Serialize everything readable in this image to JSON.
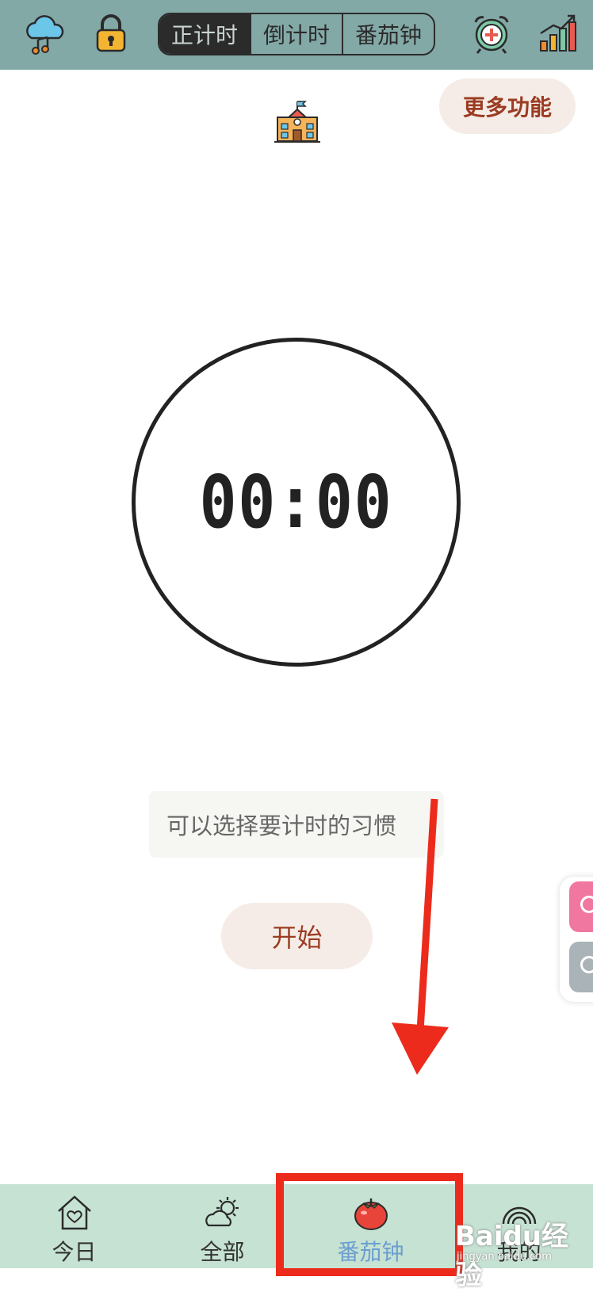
{
  "header": {
    "icons": [
      "cloud-music-icon",
      "lock-icon",
      "alarm-clock-icon",
      "bar-chart-icon"
    ],
    "segments": [
      "正计时",
      "倒计时",
      "番茄钟"
    ],
    "selected_segment": "正计时"
  },
  "more_button_label": "更多功能",
  "timer": {
    "display": "00:00"
  },
  "habit_selector": {
    "placeholder": "可以选择要计时的习惯"
  },
  "start_button_label": "开始",
  "tabbar": {
    "items": [
      {
        "label": "今日",
        "icon": "home-heart-icon"
      },
      {
        "label": "全部",
        "icon": "sun-cloud-icon"
      },
      {
        "label": "番茄钟",
        "icon": "tomato-icon",
        "active": true
      },
      {
        "label": "我的",
        "icon": "rainbow-icon"
      }
    ]
  },
  "watermark": {
    "brand": "Baidu经验",
    "url": "jingyan.baidu.com"
  },
  "colors": {
    "header_bg": "#83a9a7",
    "tabbar_bg": "#c6e2d3",
    "accent": "#9b3c22",
    "annotation": "#ec2b1c"
  }
}
